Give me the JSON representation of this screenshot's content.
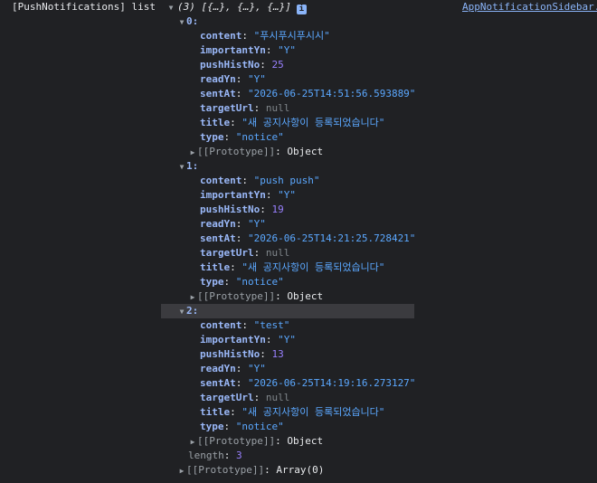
{
  "header": {
    "label": "[PushNotifications] list",
    "summary": "(3) [{…}, {…}, {…}]",
    "info_icon": "i",
    "source_link": "AppNotificationSidebar."
  },
  "items": [
    {
      "index": "0",
      "props": [
        {
          "key": "content",
          "value": "\"푸시푸시푸시시\"",
          "type": "str"
        },
        {
          "key": "importantYn",
          "value": "\"Y\"",
          "type": "str"
        },
        {
          "key": "pushHistNo",
          "value": "25",
          "type": "num"
        },
        {
          "key": "readYn",
          "value": "\"Y\"",
          "type": "str"
        },
        {
          "key": "sentAt",
          "value": "\"2026-06-25T14:51:56.593889\"",
          "type": "str"
        },
        {
          "key": "targetUrl",
          "value": "null",
          "type": "nul"
        },
        {
          "key": "title",
          "value": "\"새 공지사항이 등록되었습니다\"",
          "type": "str"
        },
        {
          "key": "type",
          "value": "\"notice\"",
          "type": "str"
        }
      ]
    },
    {
      "index": "1",
      "props": [
        {
          "key": "content",
          "value": "\"push push\"",
          "type": "str"
        },
        {
          "key": "importantYn",
          "value": "\"Y\"",
          "type": "str"
        },
        {
          "key": "pushHistNo",
          "value": "19",
          "type": "num"
        },
        {
          "key": "readYn",
          "value": "\"Y\"",
          "type": "str"
        },
        {
          "key": "sentAt",
          "value": "\"2026-06-25T14:21:25.728421\"",
          "type": "str"
        },
        {
          "key": "targetUrl",
          "value": "null",
          "type": "nul"
        },
        {
          "key": "title",
          "value": "\"새 공지사항이 등록되었습니다\"",
          "type": "str"
        },
        {
          "key": "type",
          "value": "\"notice\"",
          "type": "str"
        }
      ]
    },
    {
      "index": "2",
      "props": [
        {
          "key": "content",
          "value": "\"test\"",
          "type": "str"
        },
        {
          "key": "importantYn",
          "value": "\"Y\"",
          "type": "str"
        },
        {
          "key": "pushHistNo",
          "value": "13",
          "type": "num"
        },
        {
          "key": "readYn",
          "value": "\"Y\"",
          "type": "str"
        },
        {
          "key": "sentAt",
          "value": "\"2026-06-25T14:19:16.273127\"",
          "type": "str"
        },
        {
          "key": "targetUrl",
          "value": "null",
          "type": "nul"
        },
        {
          "key": "title",
          "value": "\"새 공지사항이 등록되었습니다\"",
          "type": "str"
        },
        {
          "key": "type",
          "value": "\"notice\"",
          "type": "str"
        }
      ]
    }
  ],
  "prototype": {
    "object_key": "[[Prototype]]",
    "object_value": "Object",
    "array_key": "[[Prototype]]",
    "array_value": "Array(0)"
  },
  "length": {
    "key": "length",
    "value": "3"
  },
  "punct": {
    "colon": ": "
  }
}
